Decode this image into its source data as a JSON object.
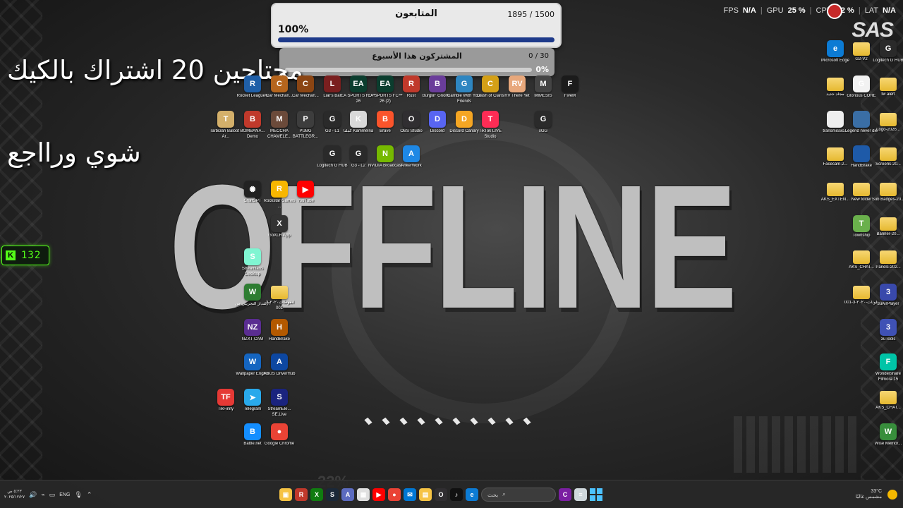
{
  "stream_overlay": {
    "followers": {
      "title": "المتابعون",
      "count": "1895 / 1500",
      "percent_label": "100%",
      "progress": 1.0
    },
    "subs": {
      "title": "المشتركون هذا الأسبوع",
      "count": "0 / 30",
      "percent_label": "0%",
      "progress": 0.0
    },
    "text_line1": "محتاجين 20 اشتراك بالكيك",
    "text_line2": "شوي ورااجع",
    "kick_count": "132",
    "offline_text": "OFFLINE",
    "brand_logo": "SAS",
    "perf": {
      "fps_label": "FPS",
      "fps": "N/A",
      "gpu_label": "GPU",
      "gpu": "25 %",
      "cpu_label": "CPU",
      "cpu": "52 %",
      "lat_label": "LAT",
      "lat": "N/A"
    }
  },
  "desktop_icons": [
    {
      "label": "Rocket League®",
      "icon": "rocket-league-icon",
      "color": "#1f5fa8",
      "glyph": "R"
    },
    {
      "label": "Car Mechan...",
      "icon": "car-mechanic-icon",
      "color": "#b5651d",
      "glyph": "C"
    },
    {
      "label": "Car Mechan...",
      "icon": "car-mechanic-icon",
      "color": "#8b4513",
      "glyph": "C"
    },
    {
      "label": "Liar's Bar",
      "icon": "liars-bar-icon",
      "color": "#7a1f1f",
      "glyph": "L"
    },
    {
      "label": "EA SPORTS FC™ 26",
      "icon": "ea-fc-icon",
      "color": "#0b3d2e",
      "glyph": "EA"
    },
    {
      "label": "EA SPORTS FC™ 26 (2)",
      "icon": "ea-fc-icon",
      "color": "#0b3d2e",
      "glyph": "EA"
    },
    {
      "label": "Rust",
      "icon": "rust-icon",
      "color": "#c0392b",
      "glyph": "R"
    },
    {
      "label": "Burglin' Gnom...",
      "icon": "burglin-gnomes-icon",
      "color": "#6a3d9a",
      "glyph": "B"
    },
    {
      "label": "Gamble With Your Friends",
      "icon": "gamble-icon",
      "color": "#2e86c1",
      "glyph": "G"
    },
    {
      "label": "Clash of Clans",
      "icon": "clash-icon",
      "color": "#d4a017",
      "glyph": "C"
    },
    {
      "label": "RV There Yet",
      "icon": "rv-there-yet-icon",
      "color": "#e8a87c",
      "glyph": "RV"
    },
    {
      "label": "MIMESIS",
      "icon": "mimesis-icon",
      "color": "#444",
      "glyph": "M"
    },
    {
      "label": "FiveM",
      "icon": "fivem-icon",
      "color": "#1b1b1b",
      "glyph": "F"
    },
    {
      "label": "Tarbi3ah Baloot - Ar...",
      "icon": "baloot-icon",
      "color": "#d4b06a",
      "glyph": "T"
    },
    {
      "label": "BOMBANA... Demo",
      "icon": "bombana-icon",
      "color": "#c0392b",
      "glyph": "B"
    },
    {
      "label": "MECCHA CHAMELE...",
      "icon": "meccha-icon",
      "color": "#6b4a3a",
      "glyph": "M"
    },
    {
      "label": "PUBG BATTLEGR...",
      "icon": "pubg-icon",
      "color": "#3d3d3d",
      "glyph": "P"
    },
    {
      "label": "G3 - L1",
      "icon": "logitech-icon",
      "color": "#2a2a2a",
      "glyph": "G"
    },
    {
      "label": "كملنا Kammelna",
      "icon": "kammelna-icon",
      "color": "#d9d9d9",
      "glyph": "K"
    },
    {
      "label": "Brave",
      "icon": "brave-icon",
      "color": "#fb542b",
      "glyph": "B"
    },
    {
      "label": "OBS Studio",
      "icon": "obs-icon",
      "color": "#302e31",
      "glyph": "O"
    },
    {
      "label": "Discord",
      "icon": "discord-icon",
      "color": "#5865f2",
      "glyph": "D"
    },
    {
      "label": "Discord Canary",
      "icon": "discord-canary-icon",
      "color": "#f5a623",
      "glyph": "D"
    },
    {
      "label": "TikTok LIVE Studio",
      "icon": "tiktok-live-icon",
      "color": "#fe2c55",
      "glyph": "T"
    },
    {
      "label": "xGG",
      "icon": "xgg-icon",
      "color": "#2a2a2a",
      "glyph": "G"
    },
    {
      "label": "Logitech G HUB",
      "icon": "logitech-icon",
      "color": "#2a2a2a",
      "glyph": "G"
    },
    {
      "label": "G3 - L2",
      "icon": "logitech-icon",
      "color": "#2a2a2a",
      "glyph": "G"
    },
    {
      "label": "NVIDIA Broadcast",
      "icon": "nvidia-icon",
      "color": "#76b900",
      "glyph": "N"
    },
    {
      "label": "AnkerWork",
      "icon": "ankerwork-icon",
      "color": "#1e88e5",
      "glyph": "A"
    },
    {
      "label": "ChatGPT",
      "icon": "chatgpt-icon",
      "color": "#222",
      "glyph": "✺"
    },
    {
      "label": "Rockstar Games ...",
      "icon": "rockstar-icon",
      "color": "#f7b600",
      "glyph": "R"
    },
    {
      "label": "YouTube",
      "icon": "youtube-icon",
      "color": "#ff0000",
      "glyph": "▶"
    },
    {
      "label": "GoXLR App",
      "icon": "goxlr-icon",
      "color": "#333",
      "glyph": "X"
    },
    {
      "label": "Streamlabs Desktop",
      "icon": "streamlabs-icon",
      "color": "#80f5d2",
      "glyph": "S"
    },
    {
      "label": "الإصدار التجريبي من",
      "icon": "app-beta-icon",
      "color": "#2e7d32",
      "glyph": "W"
    },
    {
      "label": "انقوطات٢٠٢٠-3-001",
      "icon": "folder-icon",
      "color": "folder",
      "glyph": ""
    },
    {
      "label": "NZXT CAM",
      "icon": "nzxt-icon",
      "color": "#5a2d91",
      "glyph": "NZ"
    },
    {
      "label": "HandBrake",
      "icon": "handbrake-icon",
      "color": "#b35900",
      "glyph": "H"
    },
    {
      "label": "Wallpaper Engine",
      "icon": "wallpaper-engine-icon",
      "color": "#1565c0",
      "glyph": "W"
    },
    {
      "label": "ASUS DriverHub",
      "icon": "asus-icon",
      "color": "#0d47a1",
      "glyph": "A"
    },
    {
      "label": "TikFinity",
      "icon": "tikfinity-icon",
      "color": "#e53935",
      "glyph": "TF"
    },
    {
      "label": "Telegram",
      "icon": "telegram-icon",
      "color": "#29a9eb",
      "glyph": "➤"
    },
    {
      "label": "StreamEle... SE.Live",
      "icon": "streamelements-icon",
      "color": "#1a237e",
      "glyph": "S"
    },
    {
      "label": "Battle.net",
      "icon": "battlenet-icon",
      "color": "#148eff",
      "glyph": "B"
    },
    {
      "label": "Google Chrome",
      "icon": "chrome-icon",
      "color": "#ea4335",
      "glyph": "●"
    },
    {
      "label": "Microsoft Edge",
      "icon": "edge-icon",
      "color": "#0c7bd4",
      "glyph": "e"
    },
    {
      "label": "G2-V2",
      "icon": "folder-icon",
      "color": "folder",
      "glyph": ""
    },
    {
      "label": "Logitech G HUB",
      "icon": "logitech-icon",
      "color": "#2a2a2a",
      "glyph": "G"
    },
    {
      "label": "مجلد جديد",
      "icon": "folder-icon",
      "color": "folder",
      "glyph": ""
    },
    {
      "label": "Glorious CORE",
      "icon": "glorious-icon",
      "color": "#f2f2f2",
      "glyph": "G"
    },
    {
      "label": "tw alert",
      "icon": "folder-icon",
      "color": "folder",
      "glyph": ""
    },
    {
      "label": "transmissio...",
      "icon": "file-icon",
      "color": "#eeeeee",
      "glyph": ""
    },
    {
      "label": "Legend never die",
      "icon": "image-file-icon",
      "color": "#3a6ea5",
      "glyph": ""
    },
    {
      "label": "Logo-2026...",
      "icon": "folder-icon",
      "color": "folder",
      "glyph": ""
    },
    {
      "label": "Facecam-2...",
      "icon": "folder-icon",
      "color": "folder",
      "glyph": ""
    },
    {
      "label": "HandBrake",
      "icon": "handbrake-file-icon",
      "color": "#1e5aa8",
      "glyph": ""
    },
    {
      "label": "Screens-20...",
      "icon": "folder-icon",
      "color": "folder",
      "glyph": ""
    },
    {
      "label": "AKS_EXTEN...",
      "icon": "folder-icon",
      "color": "folder",
      "glyph": ""
    },
    {
      "label": "New folder",
      "icon": "folder-icon",
      "color": "folder",
      "glyph": ""
    },
    {
      "label": "Sub Badges-20...",
      "icon": "folder-icon",
      "color": "folder",
      "glyph": ""
    },
    {
      "label": "Township",
      "icon": "township-icon",
      "color": "#6ab04c",
      "glyph": "T"
    },
    {
      "label": "Banner-20...",
      "icon": "folder-icon",
      "color": "folder",
      "glyph": ""
    },
    {
      "label": "AKS_CHAT...",
      "icon": "folder-icon",
      "color": "folder",
      "glyph": ""
    },
    {
      "label": "Panels-202...",
      "icon": "folder-icon",
      "color": "folder",
      "glyph": ""
    },
    {
      "label": "تلوثات-٢٠٢٠-3-001",
      "icon": "folder-icon",
      "color": "folder",
      "glyph": ""
    },
    {
      "label": "3uAirPlayer",
      "icon": "3uairplayer-icon",
      "color": "#3949ab",
      "glyph": "3"
    },
    {
      "label": "3uTools",
      "icon": "3utools-icon",
      "color": "#3f51b5",
      "glyph": "3"
    },
    {
      "label": "Wondershare Filmora 15",
      "icon": "filmora-icon",
      "color": "#00c4a7",
      "glyph": "F"
    },
    {
      "label": "AKS_CHAT...",
      "icon": "folder-icon",
      "color": "folder",
      "glyph": ""
    },
    {
      "label": "Wise Memor...",
      "icon": "wise-memory-icon",
      "color": "#388e3c",
      "glyph": "W"
    }
  ],
  "taskbar": {
    "time": "٥:٢٣ ص",
    "date": "٢٠٢٥/١٢/٢٧",
    "language": "ENG",
    "search_placeholder": "بحث",
    "weather_temp": "33°C",
    "weather_desc": "مشمس غالبًا",
    "apps": [
      {
        "icon": "file-explorer-icon",
        "color": "#f6c344",
        "glyph": "▣"
      },
      {
        "icon": "rockstar-icon",
        "color": "#c0392b",
        "glyph": "R"
      },
      {
        "icon": "xbox-icon",
        "color": "#107c10",
        "glyph": "X"
      },
      {
        "icon": "steam-icon",
        "color": "#1b2838",
        "glyph": "S"
      },
      {
        "icon": "app-icon",
        "color": "#5c6bc0",
        "glyph": "A"
      },
      {
        "icon": "calendar-icon",
        "color": "#e0e0e0",
        "glyph": "▦"
      },
      {
        "icon": "youtube-icon",
        "color": "#ff0000",
        "glyph": "▶"
      },
      {
        "icon": "chrome-icon",
        "color": "#ea4335",
        "glyph": "●"
      },
      {
        "icon": "mail-icon",
        "color": "#0078d4",
        "glyph": "✉"
      },
      {
        "icon": "folder-icon",
        "color": "#f6c344",
        "glyph": "▤"
      },
      {
        "icon": "obs-icon",
        "color": "#302e31",
        "glyph": "O"
      },
      {
        "icon": "tiktok-icon",
        "color": "#111",
        "glyph": "♪"
      },
      {
        "icon": "edge-icon",
        "color": "#0c7bd4",
        "glyph": "e"
      },
      {
        "icon": "copilot-icon",
        "color": "#7b1fa2",
        "glyph": "C"
      },
      {
        "icon": "notepad-icon",
        "color": "#cfd8dc",
        "glyph": "≡"
      }
    ]
  }
}
